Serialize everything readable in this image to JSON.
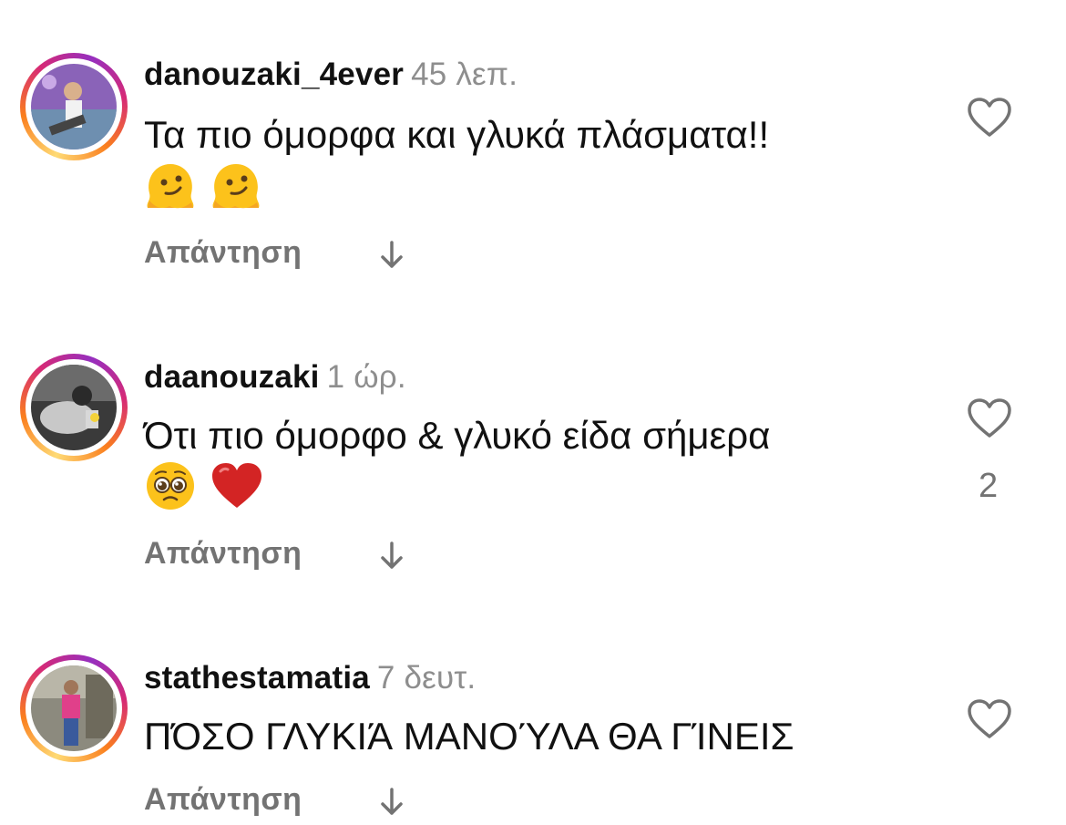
{
  "comments": [
    {
      "username": "danouzaki_4ever",
      "time": "45 λεπ.",
      "text": "Τα πιο όμορφα και γλυκά πλάσματα!!",
      "emojis": [
        "melting-face-emoji",
        "melting-face-emoji"
      ],
      "reply_label": "Απάντηση",
      "likes": ""
    },
    {
      "username": "daanouzaki",
      "time": "1 ώρ.",
      "text": "Ότι πιο όμορφο & γλυκό είδα σήμερα",
      "emojis": [
        "pleading-face-emoji",
        "red-heart-emoji"
      ],
      "reply_label": "Απάντηση",
      "likes": "2"
    },
    {
      "username": "stathestamatia",
      "time": "7 δευτ.",
      "text": "ΠΌΣΟ ΓΛΥΚΙΆ ΜΑΝΟΎΛΑ ΘΑ ΓΊΝΕΙΣ",
      "emojis": [],
      "reply_label": "Απάντηση",
      "likes": ""
    }
  ],
  "icons": {
    "like": "heart-outline-icon",
    "expand_replies": "arrow-down-icon"
  },
  "colors": {
    "text": "#111111",
    "secondary": "#8e8e8e",
    "reply": "#737373"
  }
}
